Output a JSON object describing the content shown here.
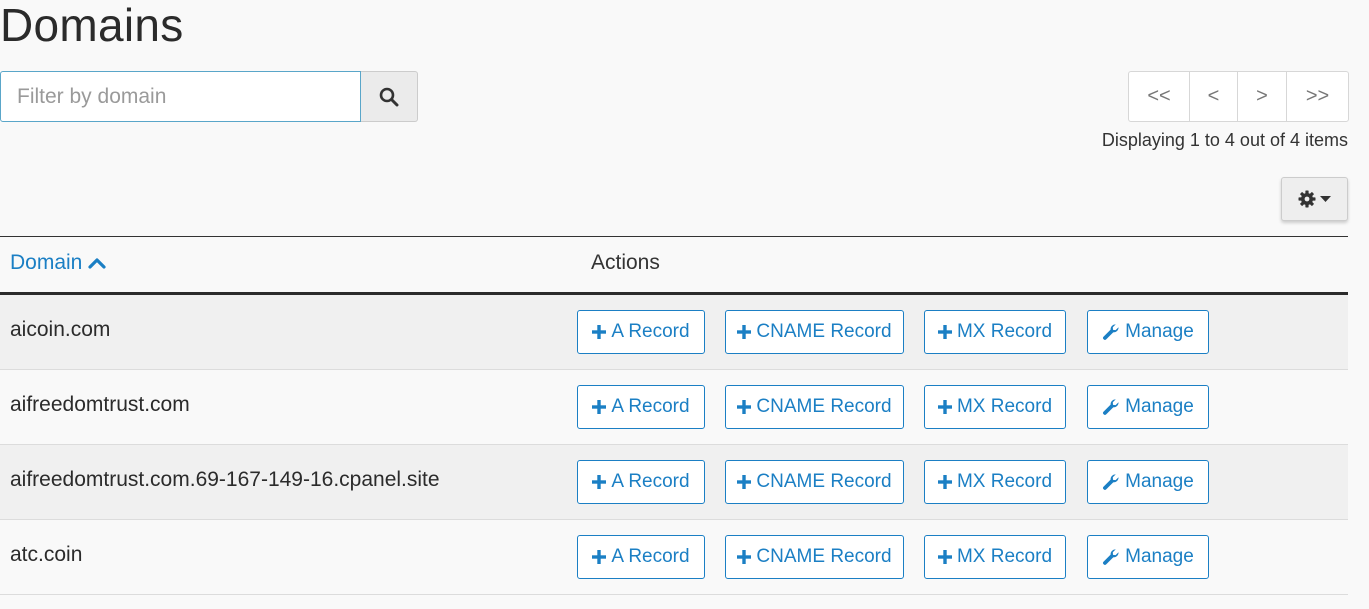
{
  "page": {
    "title": "Domains"
  },
  "search": {
    "placeholder": "Filter by domain",
    "value": "",
    "button_icon": "search-icon"
  },
  "pagination": {
    "first_label": "<<",
    "prev_label": "<",
    "next_label": ">",
    "last_label": ">>",
    "summary": "Displaying 1 to 4 out of 4 items"
  },
  "settings": {
    "icon": "gear-icon",
    "dropdown_icon": "caret-down-icon"
  },
  "table": {
    "columns": {
      "domain": "Domain",
      "actions": "Actions"
    },
    "sort": {
      "column": "domain",
      "direction": "ascending",
      "icon": "chevron-up-icon"
    },
    "action_labels": {
      "a_record": "A Record",
      "cname_record": "CNAME Record",
      "mx_record": "MX Record",
      "manage": "Manage"
    },
    "rows": [
      {
        "domain": "aicoin.com"
      },
      {
        "domain": "aifreedomtrust.com"
      },
      {
        "domain": "aifreedomtrust.com.69-167-149-16.cpanel.site"
      },
      {
        "domain": "atc.coin"
      }
    ]
  },
  "colors": {
    "link_blue": "#1b7fc4",
    "page_background": "#f9f9f9",
    "stripe_background": "#f0f0f0"
  }
}
